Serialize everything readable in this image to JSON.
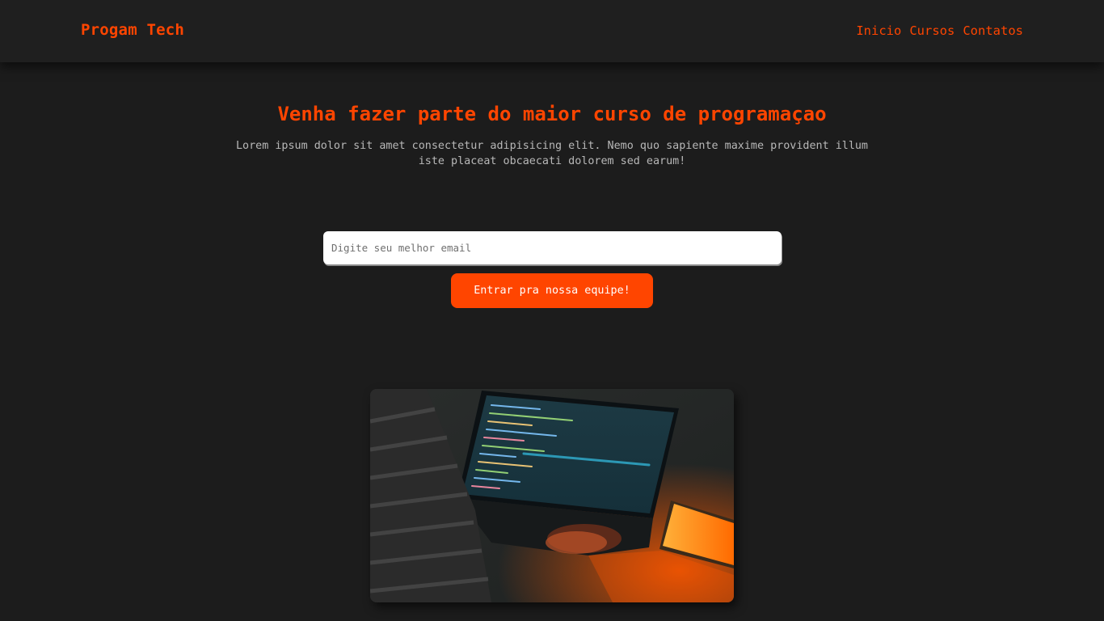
{
  "header": {
    "brand": "Progam Tech",
    "nav": [
      "Inicio",
      "Cursos",
      "Contatos"
    ]
  },
  "hero": {
    "title": "Venha fazer parte do maior curso de programaçao",
    "subtitle": "Lorem ipsum dolor sit amet consectetur adipisicing elit. Nemo quo sapiente maxime provident illum iste placeat obcaecati dolorem sed earum!"
  },
  "signup": {
    "email_placeholder": "Digite seu melhor email",
    "email_value": "",
    "button_label": "Entrar pra nossa equipe!"
  },
  "image": {
    "icon": "photo-person-coding-laptop"
  },
  "colors": {
    "accent": "#ff4500",
    "background": "#1c1c1c",
    "header_bg": "#1f1f1f",
    "subtitle_text": "#b8b8b8"
  }
}
